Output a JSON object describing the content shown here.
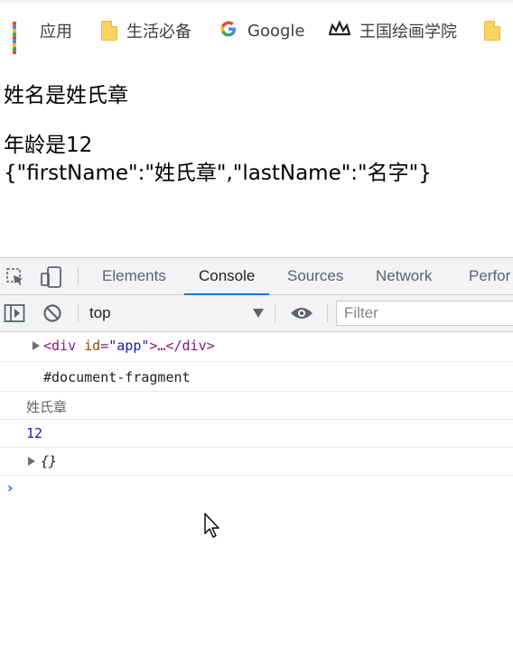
{
  "bookmarks": [
    {
      "label": "应用",
      "icon": "apps-grid-icon"
    },
    {
      "label": "生活必备",
      "icon": "folder-icon"
    },
    {
      "label": "Google",
      "icon": "google-icon"
    },
    {
      "label": "王国绘画学院",
      "icon": "crown-icon"
    }
  ],
  "page": {
    "name_line": "姓名是姓氏章",
    "age_line": "年龄是12",
    "json_line": "{\"firstName\":\"姓氏章\",\"lastName\":\"名字\"}"
  },
  "devtools": {
    "tabs": [
      "Elements",
      "Console",
      "Sources",
      "Network",
      "Perfor"
    ],
    "active_tab": "Console",
    "context": "top",
    "filter_placeholder": "Filter"
  },
  "console": {
    "row1": {
      "open": "<",
      "tag": "div",
      "attr": "id",
      "eq": "=",
      "value": "\"app\"",
      "mid": ">…</",
      "close_tag": "div",
      "end": ">"
    },
    "row2": "#document-fragment",
    "row3": "姓氏章",
    "row4": "12",
    "row5": "{}"
  },
  "colors": {
    "accent": "#1a73e8",
    "tag": "#881280",
    "attr": "#994500",
    "value": "#1a1aa6"
  }
}
